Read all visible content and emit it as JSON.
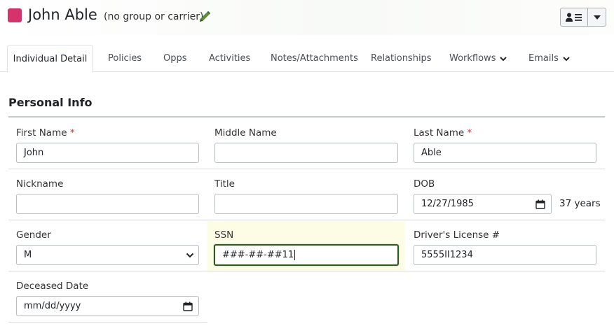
{
  "header": {
    "contact_name": "John Able",
    "group_note": "(no group or carrier)",
    "swatch_color": "#d6336c",
    "edit_icon": "pencil-icon",
    "menu_icons": [
      "contact-list-icon",
      "caret-down-icon"
    ]
  },
  "tabs": [
    {
      "label": "Individual Detail",
      "active": true
    },
    {
      "label": "Policies"
    },
    {
      "label": "Opps"
    },
    {
      "label": "Activities"
    },
    {
      "label": "Notes/Attachments"
    },
    {
      "label": "Relationships"
    },
    {
      "label": "Workflows",
      "dropdown": true
    },
    {
      "label": "Emails",
      "dropdown": true
    }
  ],
  "section": {
    "title": "Personal Info"
  },
  "fields": {
    "first_name": {
      "label": "First Name",
      "required": "*",
      "value": "John"
    },
    "middle_name": {
      "label": "Middle Name",
      "value": ""
    },
    "last_name": {
      "label": "Last Name",
      "required": "*",
      "value": "Able"
    },
    "nickname": {
      "label": "Nickname",
      "value": ""
    },
    "title": {
      "label": "Title",
      "value": ""
    },
    "dob": {
      "label": "DOB",
      "value": "12/27/1985",
      "age": "37 years"
    },
    "gender": {
      "label": "Gender",
      "value": "M"
    },
    "ssn": {
      "label": "SSN",
      "value": "###-##-##11"
    },
    "drivers_license": {
      "label": "Driver's License #",
      "value": "5555II1234"
    },
    "deceased_date": {
      "label": "Deceased Date",
      "value": "mm/dd/yyyy"
    }
  }
}
